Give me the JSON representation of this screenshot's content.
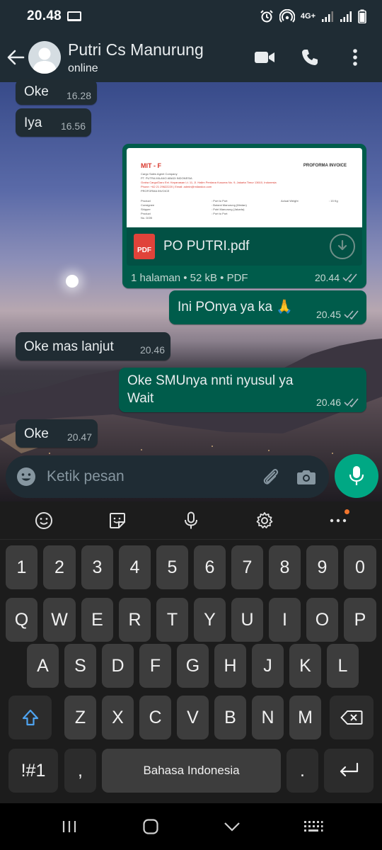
{
  "status_bar": {
    "time": "20.48",
    "network": "4G+"
  },
  "header": {
    "name": "Putri Cs Manurung",
    "status": "online"
  },
  "messages": [
    {
      "direction": "in",
      "text": "Oke",
      "time": "16.28"
    },
    {
      "direction": "in",
      "text": "Iya",
      "time": "16.56"
    },
    {
      "direction": "in",
      "text": "Oke mas lanjut",
      "time": "20.46"
    },
    {
      "direction": "out",
      "text": "Ini POnya ya ka 🙏",
      "time": "20.45"
    },
    {
      "direction": "out",
      "text": "Oke SMUnya nnti nyusul ya Wait",
      "time": "20.46"
    },
    {
      "direction": "in",
      "text": "Oke",
      "time": "20.47"
    }
  ],
  "pdf_message": {
    "filename": "PO PUTRI.pdf",
    "info": "1 halaman • 52 kB • PDF",
    "time": "20.44",
    "preview": {
      "logo": "MIT - F",
      "title": "PROFORMA INVOICE",
      "lines": [
        "Cargo Sales Agent Company",
        "PT. PUTRA MILANO ABADI INDONESIA",
        "Graha Cargo/Daru Ext. Kepanasan Lt. 11, Jl. Halim Perdana Kusuma No. 9, Jakarta Timur 13610, Indonesia",
        "Phone: +62 21 29622220 | Email: admin@milandox.com",
        "PROFORMA INVOICE"
      ],
      "rows": [
        [
          "Product",
          ": Port to Port",
          "Actual Weight",
          ": 15 Kg"
        ],
        [
          "Consignee",
          ": Butami Manurung (Medan)",
          "",
          ""
        ],
        [
          "Shipper",
          ": Putri Manurung (Jakarta)",
          "",
          ""
        ],
        [
          "Product",
          ": Port to Port",
          "",
          ""
        ],
        [
          "No. DOB",
          "",
          "",
          ""
        ]
      ]
    }
  },
  "composer": {
    "placeholder": "Ketik pesan"
  },
  "keyboard": {
    "row_numbers": [
      "1",
      "2",
      "3",
      "4",
      "5",
      "6",
      "7",
      "8",
      "9",
      "0"
    ],
    "row_top": [
      "Q",
      "W",
      "E",
      "R",
      "T",
      "Y",
      "U",
      "I",
      "O",
      "P"
    ],
    "row_mid": [
      "A",
      "S",
      "D",
      "F",
      "G",
      "H",
      "J",
      "K",
      "L"
    ],
    "row_bottom": [
      "Z",
      "X",
      "C",
      "V",
      "B",
      "N",
      "M"
    ],
    "symbols_label": "!#1",
    "comma_label": ",",
    "space_label": "Bahasa Indonesia",
    "period_label": "."
  }
}
